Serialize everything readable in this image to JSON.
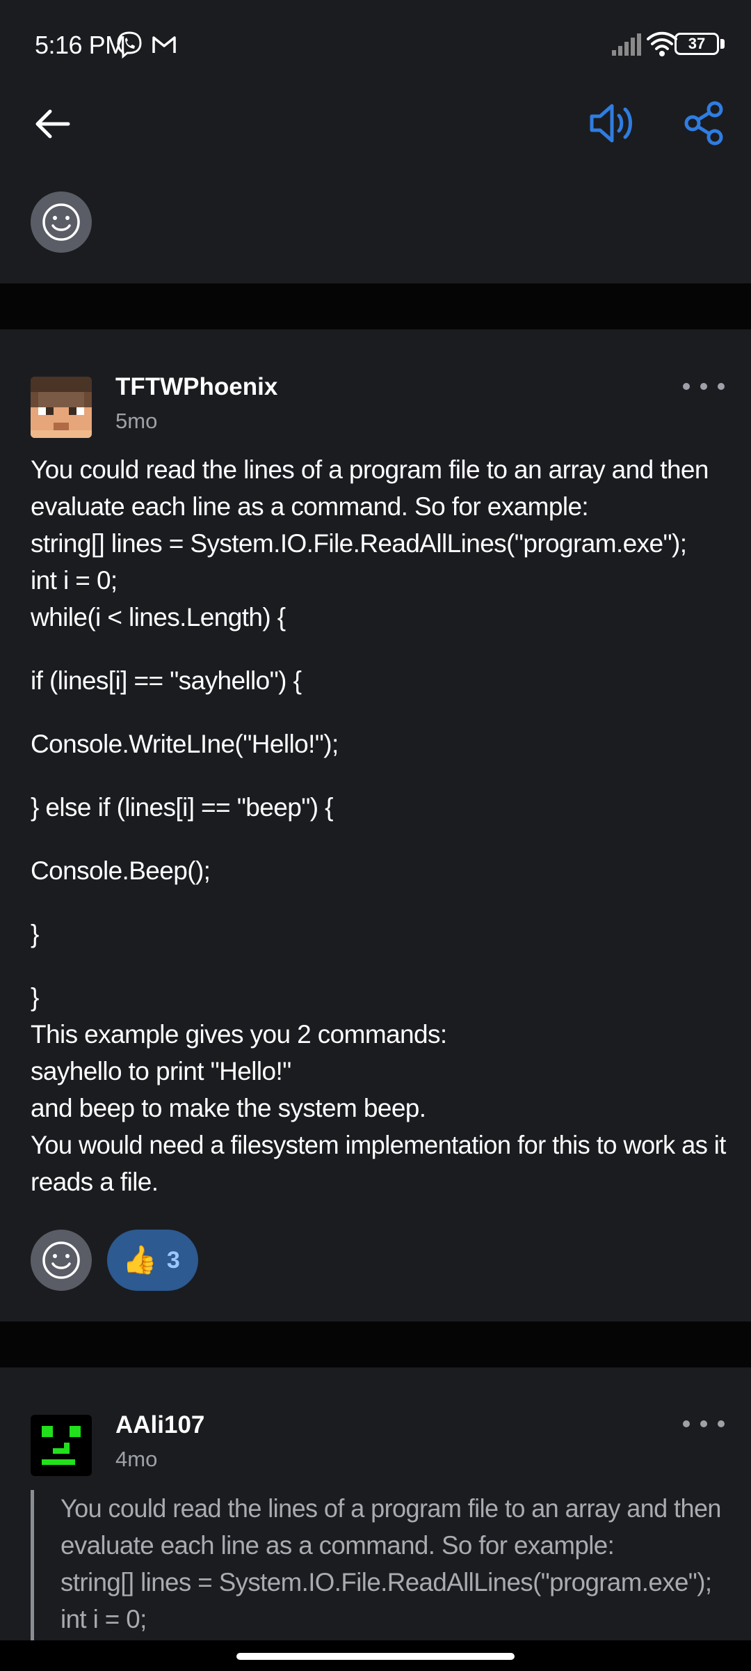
{
  "status_bar": {
    "time": "5:16 PM",
    "battery": "37",
    "icons": [
      "viber-icon",
      "gmail-icon",
      "signal-icon",
      "wifi-icon",
      "battery-icon"
    ]
  },
  "toolbar": {
    "back_icon": "arrow-left-icon",
    "speaker_icon": "speaker-icon",
    "share_icon": "share-icon",
    "accent_color": "#2f7de1"
  },
  "comments": [
    {
      "username": "TFTWPhoenix",
      "time_ago": "5mo",
      "lines": [
        "You could read the lines of a program file to an array and then",
        "evaluate each line as a command. So for example:",
        "string[] lines = System.IO.File.ReadAllLines(\"program.exe\");",
        "int i = 0;",
        "while(i < lines.Length) {",
        "",
        "if (lines[i] == \"sayhello\") {",
        "",
        "Console.WriteLIne(\"Hello!\");",
        "",
        "} else if (lines[i] == \"beep\") {",
        "",
        "Console.Beep();",
        "",
        "}",
        "",
        "}",
        "This example gives you 2 commands:",
        "sayhello to print \"Hello!\"",
        "and beep to make the system beep.",
        "You would need a filesystem implementation for this to work as it",
        "reads a file."
      ],
      "reaction_emoji": "👍",
      "reaction_count": "3"
    },
    {
      "username": "AAli107",
      "time_ago": "4mo",
      "quote_lines": [
        "You could read the lines of a program file to an array and then",
        "evaluate each line as a command. So for example:",
        "string[] lines = System.IO.File.ReadAllLines(\"program.exe\");",
        "int i = 0;"
      ]
    }
  ]
}
